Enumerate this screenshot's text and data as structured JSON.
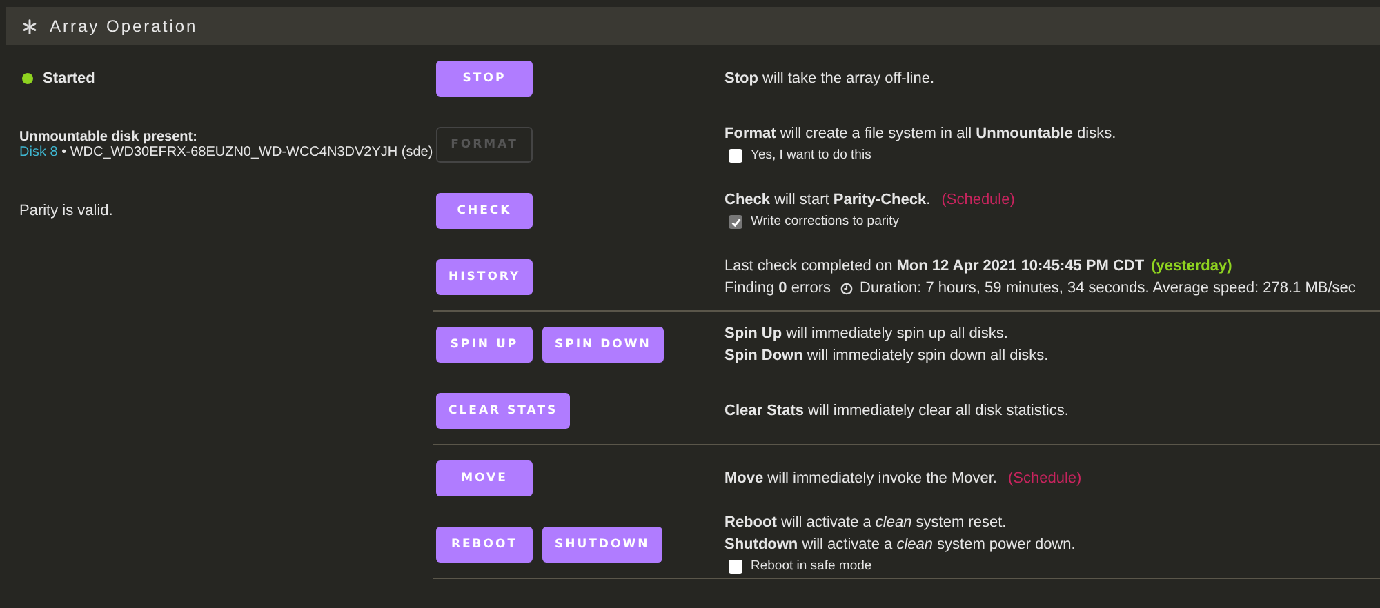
{
  "header": {
    "title": "Array Operation"
  },
  "sections": [
    {
      "rows": [
        {
          "left": {
            "kind": "status",
            "text": "Started",
            "color": "#8fd320"
          },
          "buttons": [
            {
              "label": "STOP",
              "disabled": false
            }
          ],
          "lines": [
            [
              {
                "kind": "text",
                "text": "**Stop** will take the array off-line."
              }
            ]
          ]
        },
        {
          "left": {
            "kind": "disk",
            "title": "Unmountable disk present:",
            "link": "Disk 8",
            "text": "• WDC_WD30EFRX-68EUZN0_WD-WCC4N3DV2YJH (sde)"
          },
          "buttons": [
            {
              "label": "FORMAT",
              "disabled": true
            }
          ],
          "lines": [
            [
              {
                "kind": "text",
                "text": "**Format** will create a file system in all **Unmountable** disks."
              }
            ]
          ],
          "checkbox": {
            "label": "Yes, I want to do this",
            "checked": false
          }
        },
        {
          "left": {
            "kind": "plain",
            "text": "Parity is valid."
          },
          "buttons": [
            {
              "label": "CHECK",
              "disabled": false
            }
          ],
          "lines": [
            [
              {
                "kind": "text",
                "text": "**Check** will start **Parity-Check**."
              },
              {
                "kind": "link",
                "text": "(Schedule)"
              }
            ]
          ],
          "checkbox": {
            "label": "Write corrections to parity",
            "checked": true
          }
        },
        {
          "buttons": [
            {
              "label": "HISTORY",
              "disabled": false
            }
          ],
          "lines": [
            [
              {
                "kind": "text",
                "text": "Last check completed on **Mon 12 Apr 2021 10:45:45 PM CDT**"
              },
              {
                "kind": "good",
                "text": "(yesterday)"
              }
            ],
            [
              {
                "kind": "text",
                "text": "Finding **0** errors"
              },
              {
                "kind": "timed",
                "text": "Duration: 7 hours, 59 minutes, 34 seconds. Average speed: 278.1 MB/sec"
              }
            ]
          ]
        }
      ]
    },
    {
      "rows": [
        {
          "buttons": [
            {
              "label": "SPIN UP",
              "disabled": false
            },
            {
              "label": "SPIN DOWN",
              "disabled": false
            }
          ],
          "lines": [
            [
              {
                "kind": "text",
                "text": "**Spin Up** will immediately spin up all disks."
              }
            ],
            [
              {
                "kind": "text",
                "text": "**Spin Down** will immediately spin down all disks."
              }
            ]
          ]
        },
        {
          "buttons": [
            {
              "label": "CLEAR STATS",
              "disabled": false
            }
          ],
          "lines": [
            [
              {
                "kind": "text",
                "text": "**Clear Stats** will immediately clear all disk statistics."
              }
            ]
          ]
        }
      ]
    },
    {
      "rows": [
        {
          "buttons": [
            {
              "label": "MOVE",
              "disabled": false
            }
          ],
          "lines": [
            [
              {
                "kind": "text",
                "text": "**Move** will immediately invoke the Mover."
              },
              {
                "kind": "link",
                "text": "(Schedule)"
              }
            ]
          ]
        },
        {
          "buttons": [
            {
              "label": "REBOOT",
              "disabled": false
            },
            {
              "label": "SHUTDOWN",
              "disabled": false
            }
          ],
          "lines": [
            [
              {
                "kind": "text",
                "text": "**Reboot** will activate a *clean* system reset."
              }
            ],
            [
              {
                "kind": "text",
                "text": "**Shutdown** will activate a *clean* system power down."
              }
            ]
          ],
          "checkbox": {
            "label": "Reboot in safe mode",
            "checked": false
          }
        }
      ]
    }
  ]
}
